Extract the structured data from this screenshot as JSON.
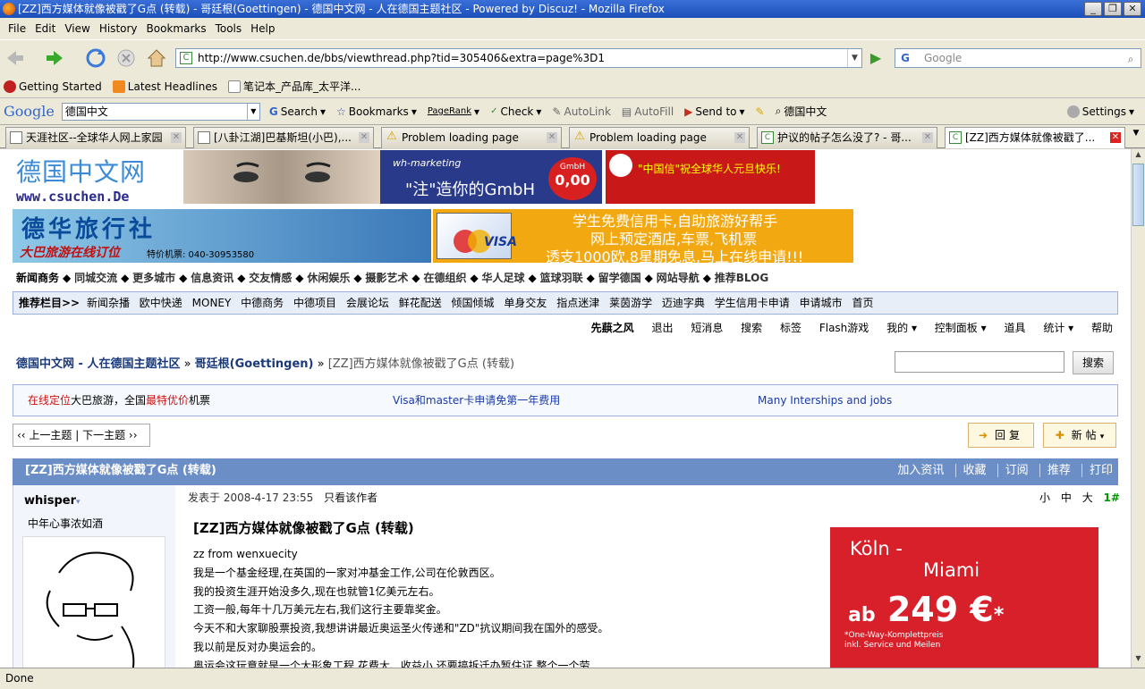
{
  "window": {
    "title": "[ZZ]西方媒体就像被戳了G点 (转载) - 哥廷根(Goettingen) - 德国中文网 - 人在德国主题社区 - Powered by Discuz! - Mozilla Firefox",
    "buttons": [
      "_",
      "❐",
      "✕"
    ]
  },
  "menu": [
    "File",
    "Edit",
    "View",
    "History",
    "Bookmarks",
    "Tools",
    "Help"
  ],
  "nav": {
    "url": "http://www.csuchen.de/bbs/viewthread.php?tid=305406&extra=page%3D1",
    "search_placeholder": "Google"
  },
  "bookmarks": [
    "Getting Started",
    "Latest Headlines",
    "笔记本_产品库_太平洋..."
  ],
  "google_toolbar": {
    "logo": "Google",
    "query": "德国中文",
    "items": [
      "Search",
      "Bookmarks",
      "PageRank",
      "Check",
      "AutoLink",
      "AutoFill",
      "Send to",
      "德国中文"
    ],
    "settings": "Settings"
  },
  "tabs": [
    {
      "label": "天涯社区--全球华人网上家园"
    },
    {
      "label": "[八卦江湖]巴基斯坦(小巴),..."
    },
    {
      "label": "Problem loading page"
    },
    {
      "label": "Problem loading page"
    },
    {
      "label": "护议的帖子怎么没了? - 哥..."
    },
    {
      "label": "[ZZ]西方媒体就像被戳了..."
    }
  ],
  "site": {
    "logo_cn": "德国中文网",
    "logo_url": "www.csuchen.De",
    "banners": {
      "wh_marketing": "wh-marketing",
      "wh_slogan": "\"注\"造你的GmbH",
      "gmbh_label": "GmbH",
      "gmbh_price": "0,00",
      "xinyi": "\"中国信\"祝全球华人元旦快乐!",
      "travel_title": "德华旅行社",
      "travel_sub": "大巴旅游在线订位",
      "travel_phone": "特价机票: 040-30953580",
      "card_line1": "学生免费信用卡,自助旅游好帮手",
      "card_line2": "网上预定酒店,车票,飞机票",
      "card_line3": "透支1000欧,8星期免息,马上在线申请!!!"
    },
    "navlinks": [
      "新闻商务",
      "同城交流",
      "更多城市",
      "信息资讯",
      "交友情感",
      "休闲娱乐",
      "摄影艺术",
      "在德组织",
      "华人足球",
      "篮球羽联",
      "留学德国",
      "网站导航",
      "推荐BLOG"
    ],
    "recommend_label": "推荐栏目>>",
    "recommend": [
      "新闻杂播",
      "欧中快递",
      "MONEY",
      "中德商务",
      "中德项目",
      "会展论坛",
      "鲜花配送",
      "倾国倾城",
      "单身交友",
      "指点迷津",
      "莱茵游学",
      "迈迪字典",
      "学生信用卡申请",
      "申请城市",
      "首页"
    ],
    "user": "先蕻之风",
    "usermenu": [
      "退出",
      "短消息",
      "搜索",
      "标签",
      "Flash游戏",
      "我的 ▾",
      "控制面板 ▾",
      "道具",
      "统计 ▾",
      "帮助"
    ],
    "crumb": {
      "home": "德国中文网 - 人在德国主题社区",
      "forum": "哥廷根(Goettingen)",
      "current": "[ZZ]西方媒体就像被戳了G点 (转载)"
    },
    "search_button": "搜索",
    "ads": {
      "a1_red1": "在线定位",
      "a1_mid": "大巴旅游，全国",
      "a1_red2": "最特优价",
      "a1_end": "机票",
      "a2": "Visa和master卡申请免第一年费用",
      "a3": "Many Interships and jobs"
    },
    "threadnav": "‹‹ 上一主题 | 下一主题 ››",
    "reply_btn": "回复",
    "new_btn": "新帖",
    "thread_title": "[ZZ]西方媒体就像被戳了G点 (转载)",
    "thread_actions": [
      "加入资讯",
      "收藏",
      "订阅",
      "推荐",
      "打印"
    ],
    "author": {
      "name": "whisper",
      "signature": "中年心事浓如酒"
    },
    "post": {
      "meta": "发表于 2008-4-17 23:55",
      "only_author": "只看该作者",
      "sizes": [
        "小",
        "中",
        "大"
      ],
      "floor": "1#",
      "title": "[ZZ]西方媒体就像被戳了G点 (转载)",
      "lines": [
        "zz from wenxuecity",
        "我是一个基金经理,在英国的一家对冲基金工作,公司在伦敦西区。",
        "我的投资生涯开始没多久,现在也就管1亿美元左右。",
        "工资一般,每年十几万美元左右,我们这行主要靠奖金。",
        "今天不和大家聊股票投资,我想讲讲最近奥运圣火传递和\"ZD\"抗议期间我在国外的感受。",
        "我以前是反对办奥运会的。",
        "奥运会这玩意就是一个大形象工程,花费大、收益小,还要搞拆迁办暂住证,整个一个劳"
      ]
    },
    "side_ad": {
      "city1": "Köln -",
      "city2": "Miami",
      "ab": "ab",
      "price": "249 €",
      "star": "*",
      "note1": "*One-Way-Komplettpreis",
      "note2": "inkl. Service und Meilen"
    }
  },
  "status": "Done",
  "colors": {
    "accent_blue": "#6c8ec6",
    "ad_red": "#d8202a"
  }
}
